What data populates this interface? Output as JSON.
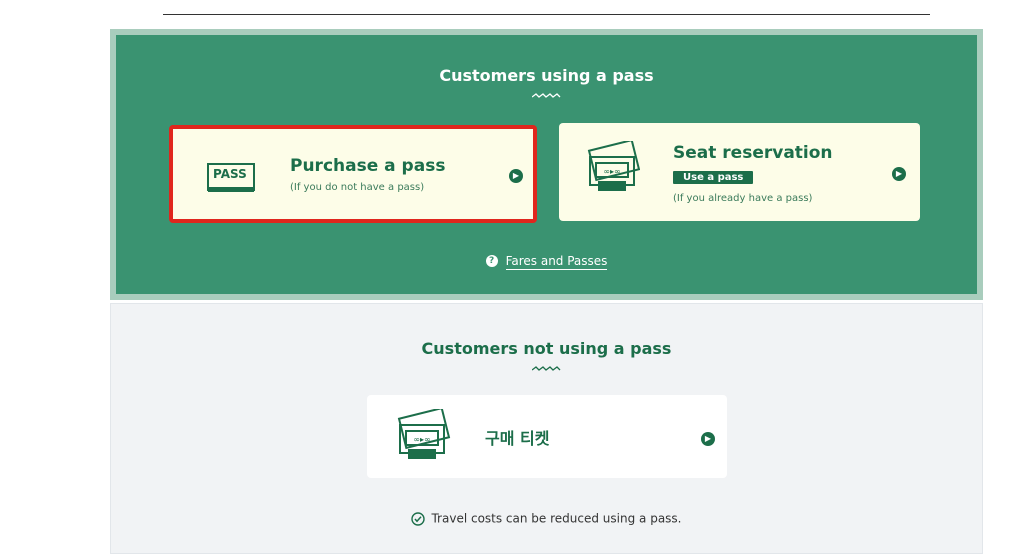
{
  "pass_section": {
    "title": "Customers using a pass",
    "purchase_card": {
      "icon_label": "PASS",
      "title": "Purchase a pass",
      "subtitle": "(If you do not have a pass)"
    },
    "seat_card": {
      "title": "Seat reservation",
      "badge": "Use a pass",
      "subtitle": "(If you already have a pass)"
    },
    "fares_link": "Fares and Passes"
  },
  "nopass_section": {
    "title": "Customers not using a pass",
    "buy_card": {
      "title": "구매 티켓"
    },
    "note": "Travel costs can be reduced using a pass."
  },
  "colors": {
    "primary_green": "#3a9371",
    "dark_green": "#1c6e4a",
    "card_bg": "#fdfde8",
    "highlight_red": "#e0261d",
    "light_bg": "#f1f3f5"
  },
  "icons": [
    "pass-card-icon",
    "ticket-icon",
    "chevron-right-icon",
    "help-icon",
    "check-circle-icon"
  ]
}
